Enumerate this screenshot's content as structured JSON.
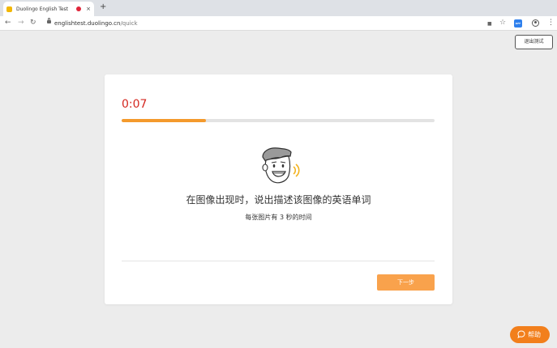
{
  "browser": {
    "tab_title": "Duolingo English Test",
    "tab_close": "×",
    "new_tab": "+",
    "url_host": "englishtest.duolingo.cn",
    "url_path": "/quick",
    "back": "←",
    "forward": "→",
    "reload": "↻",
    "camera": "■",
    "star": "☆",
    "extension_badge": "OFF",
    "menu": "⋮"
  },
  "page": {
    "exit_label": "退出测试",
    "timer": "0:07",
    "progress_percent": 27,
    "instruction": "在图像出现时，说出描述该图像的英语单词",
    "subtext": "每张图片有 3 秒的时间",
    "next_label": "下一步",
    "help_label": "帮助"
  },
  "colors": {
    "timer": "#d4271f",
    "progress": "#f49a2c",
    "next_button": "#f9a24c",
    "help_button": "#f27f1c"
  },
  "icons": {
    "illustration": "speaking-face-icon",
    "help": "chat-bubble-icon"
  }
}
